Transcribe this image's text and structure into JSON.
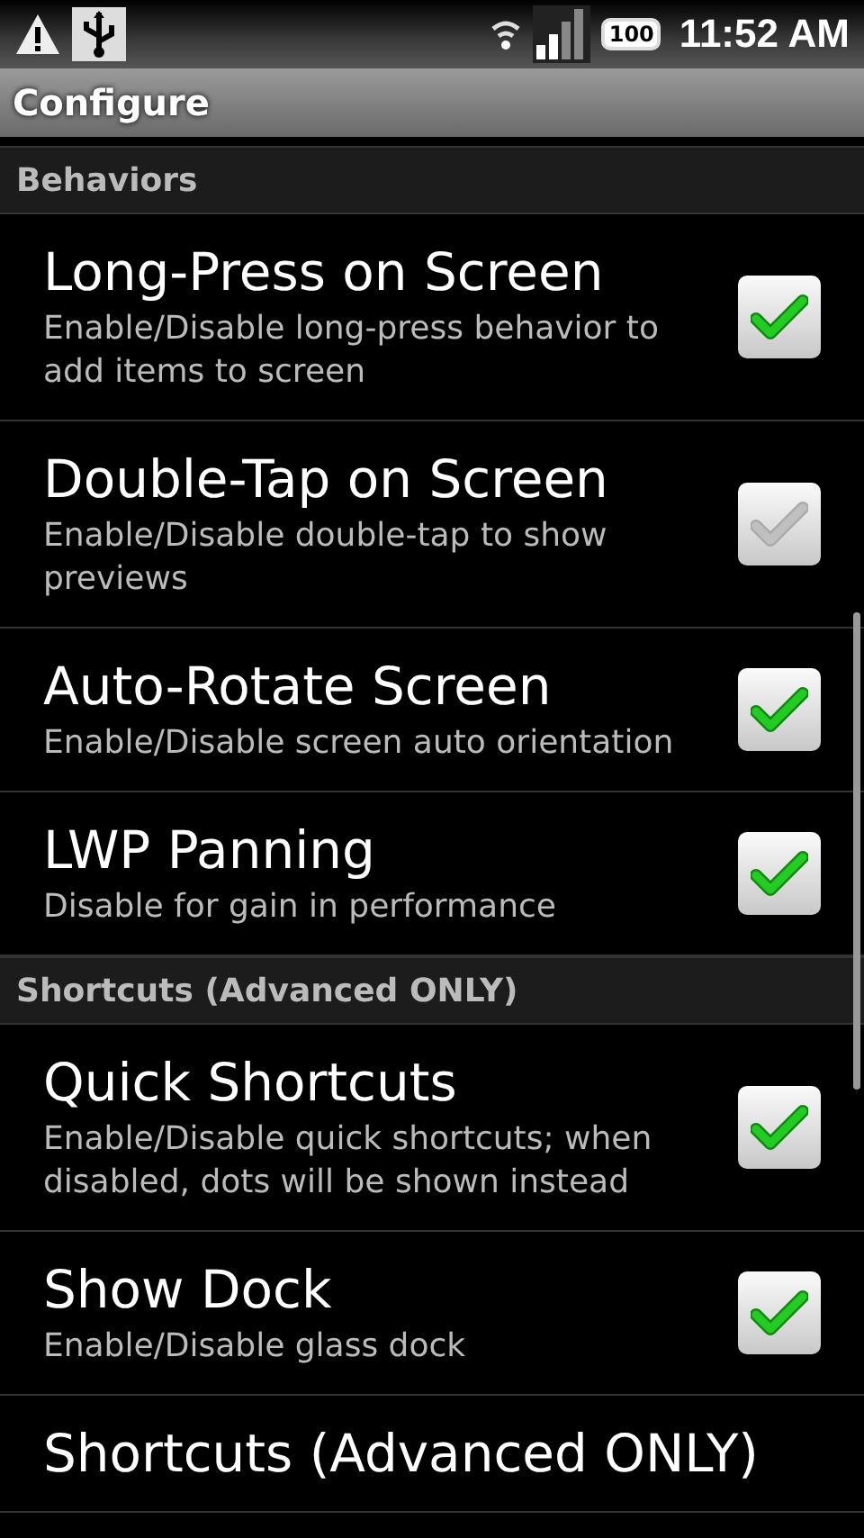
{
  "status_bar": {
    "battery": "100",
    "time": "11:52 AM"
  },
  "title_bar": {
    "title": "Configure"
  },
  "sections": [
    {
      "header": "Behaviors",
      "items": [
        {
          "title": "Long-Press on Screen",
          "summary": "Enable/Disable long-press behavior to add items to screen",
          "checked": true,
          "disabled": false
        },
        {
          "title": "Double-Tap on Screen",
          "summary": "Enable/Disable double-tap to show previews",
          "checked": true,
          "disabled": true
        },
        {
          "title": "Auto-Rotate Screen",
          "summary": "Enable/Disable screen auto orientation",
          "checked": true,
          "disabled": false
        },
        {
          "title": "LWP Panning",
          "summary": "Disable for gain in performance",
          "checked": true,
          "disabled": false
        }
      ]
    },
    {
      "header": "Shortcuts (Advanced ONLY)",
      "items": [
        {
          "title": "Quick Shortcuts",
          "summary": "Enable/Disable quick shortcuts; when disabled, dots will be shown instead",
          "checked": true,
          "disabled": false
        },
        {
          "title": "Show Dock",
          "summary": "Enable/Disable glass dock",
          "checked": true,
          "disabled": false
        },
        {
          "title": "Shortcuts (Advanced ONLY)"
        }
      ]
    }
  ]
}
